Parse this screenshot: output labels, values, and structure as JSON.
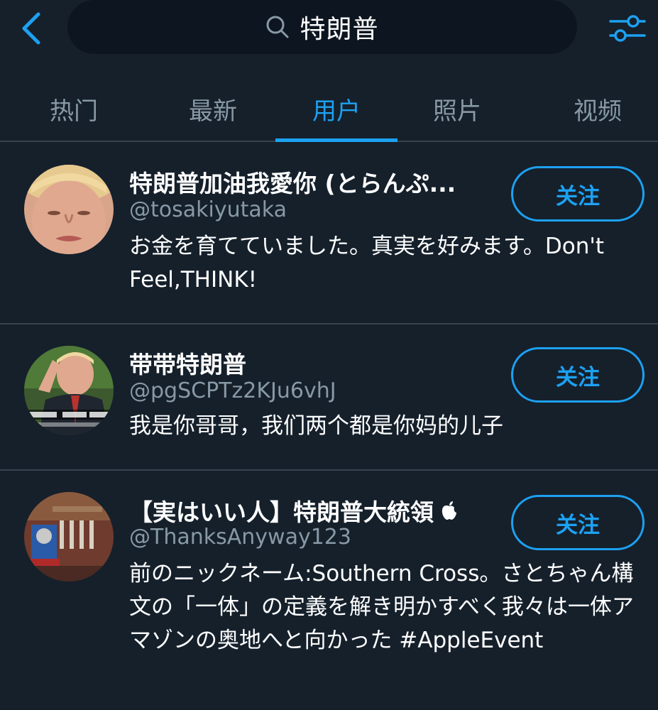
{
  "search": {
    "query": "特朗普"
  },
  "icons": {
    "back": "chevron-left-icon",
    "search": "search-icon",
    "filter": "sliders-icon",
    "verified_like": "apple-icon"
  },
  "colors": {
    "background": "#15202b",
    "accent": "#1da1f2",
    "secondary_text": "#8899a6",
    "divider": "#38444d"
  },
  "tabs": [
    {
      "label": "热门",
      "active": false
    },
    {
      "label": "最新",
      "active": false
    },
    {
      "label": "用户",
      "active": true
    },
    {
      "label": "照片",
      "active": false
    },
    {
      "label": "视频",
      "active": false
    }
  ],
  "users": [
    {
      "name": "特朗普加油我愛你 (とらんぷ...",
      "handle": "@tosakiyutaka",
      "bio": "お金を育てていました。真実を好みます。Don't Feel,THINK!",
      "follow_label": "关注"
    },
    {
      "name": "带带特朗普",
      "handle": "@pgSCPTz2KJu6vhJ",
      "bio": "我是你哥哥，我们两个都是你妈的儿子",
      "follow_label": "关注"
    },
    {
      "name": "【実はいい人】特朗普大統領",
      "handle": "@ThanksAnyway123",
      "bio": "前のニックネーム:Southern Cross。さとちゃん構文の「一体」の定義を解き明かすべく我々は一体アマゾンの奥地へと向かった #AppleEvent",
      "follow_label": "关注"
    }
  ]
}
